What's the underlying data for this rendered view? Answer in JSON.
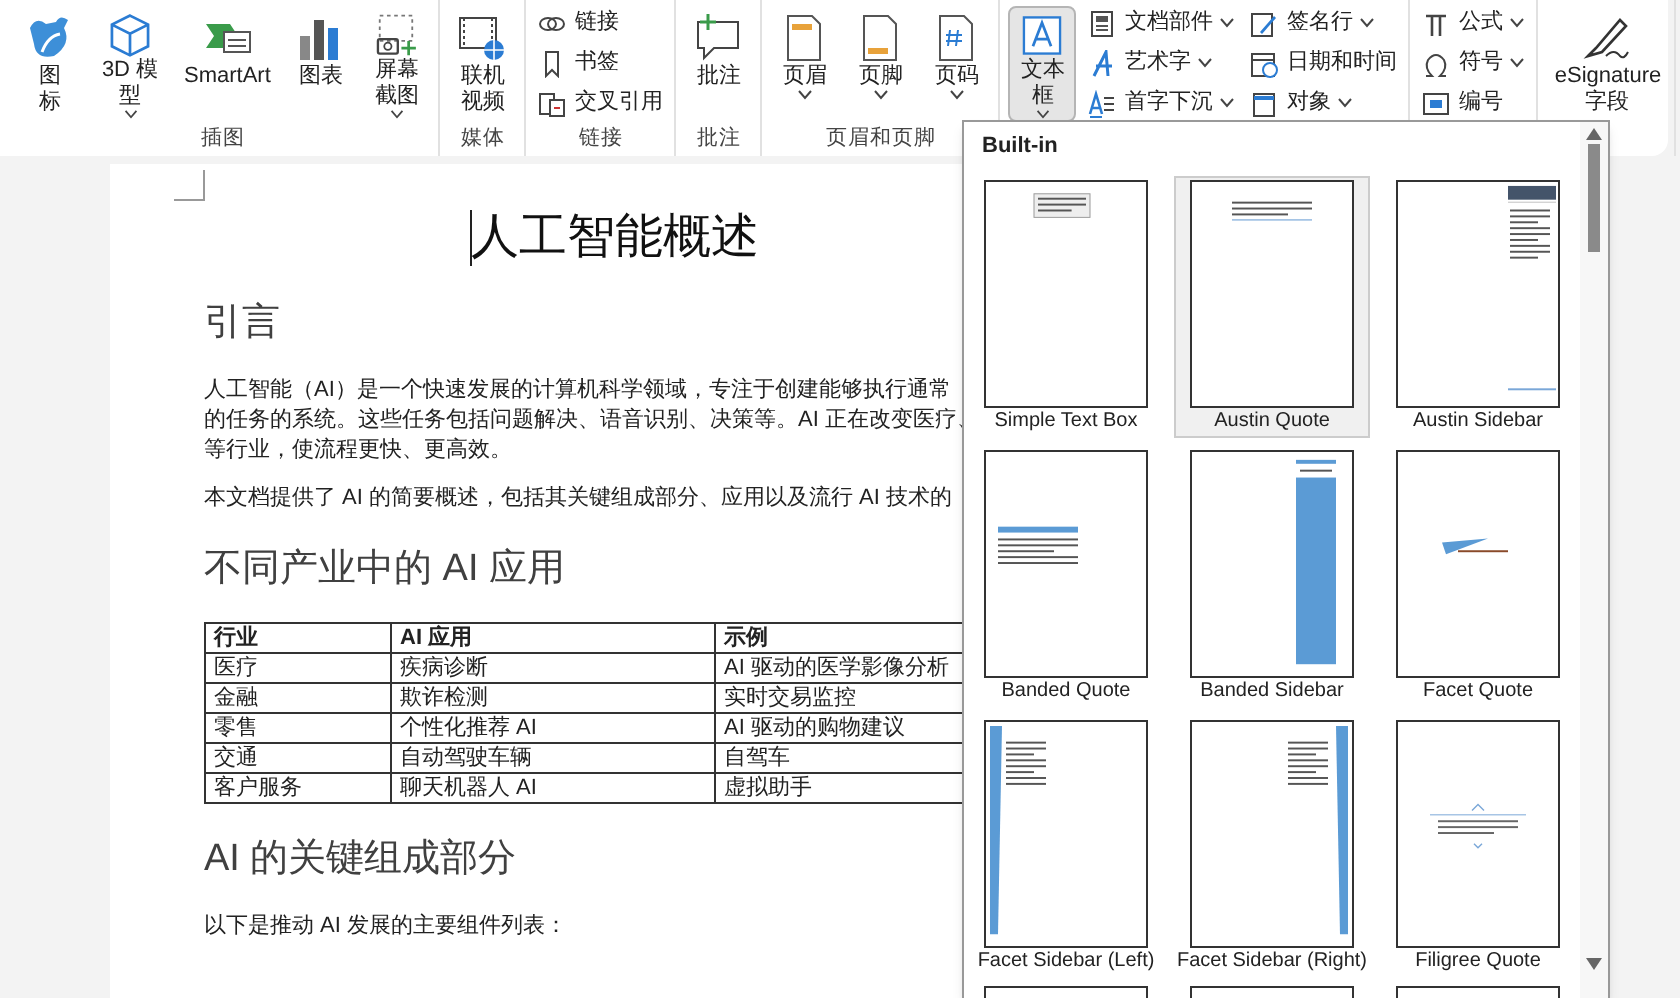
{
  "ribbon": {
    "groups": [
      {
        "label": "插图",
        "items": [
          {
            "kind": "large",
            "label": "图标",
            "has_menu": false,
            "selected": false
          },
          {
            "kind": "large",
            "label": "3D 模型",
            "has_menu": true,
            "selected": false
          },
          {
            "kind": "large",
            "label": "SmartArt",
            "has_menu": false,
            "selected": false
          },
          {
            "kind": "large",
            "label": "图表",
            "has_menu": false,
            "selected": false
          },
          {
            "kind": "large",
            "label": "屏幕截图",
            "has_menu": true,
            "selected": false
          }
        ]
      },
      {
        "label": "媒体",
        "items": [
          {
            "kind": "large",
            "label": "联机视频",
            "has_menu": false,
            "selected": false
          }
        ]
      },
      {
        "label": "链接",
        "items": [
          {
            "kind": "stack",
            "children": [
              {
                "label": "链接",
                "has_menu": false
              },
              {
                "label": "书签",
                "has_menu": false
              },
              {
                "label": "交叉引用",
                "has_menu": false
              }
            ]
          }
        ]
      },
      {
        "label": "批注",
        "items": [
          {
            "kind": "large",
            "label": "批注",
            "has_menu": false,
            "selected": false
          }
        ]
      },
      {
        "label": "页眉和页脚",
        "items": [
          {
            "kind": "large",
            "label": "页眉",
            "has_menu": true,
            "selected": false
          },
          {
            "kind": "large",
            "label": "页脚",
            "has_menu": true,
            "selected": false
          },
          {
            "kind": "large",
            "label": "页码",
            "has_menu": true,
            "selected": false
          }
        ]
      },
      {
        "items": [
          {
            "kind": "large",
            "label": "文本框",
            "has_menu": true,
            "selected": true
          },
          {
            "kind": "stack",
            "children": [
              {
                "label": "文档部件",
                "has_menu": true
              },
              {
                "label": "艺术字",
                "has_menu": true
              },
              {
                "label": "首字下沉",
                "has_menu": true
              }
            ]
          },
          {
            "kind": "stack",
            "children": [
              {
                "label": "签名行",
                "has_menu": true
              },
              {
                "label": "日期和时间",
                "has_menu": false
              },
              {
                "label": "对象",
                "has_menu": true
              }
            ]
          }
        ]
      },
      {
        "items": [
          {
            "kind": "stack",
            "children": [
              {
                "label": "公式",
                "has_menu": true
              },
              {
                "label": "符号",
                "has_menu": true
              },
              {
                "label": "编号",
                "has_menu": false
              }
            ]
          }
        ]
      },
      {
        "items": [
          {
            "kind": "large",
            "label": "eSignature 字段",
            "has_menu": false,
            "selected": false
          }
        ]
      }
    ]
  },
  "document": {
    "title": "人工智能概述",
    "blocks": [
      {
        "kind": "heading",
        "text": "引言"
      },
      {
        "kind": "paragraph",
        "lines": [
          "人工智能（AI）是一个快速发展的计算机科学领域，专注于创建能够执行通常",
          "的任务的系统。这些任务包括问题解决、语音识别、决策等。AI 正在改变医疗、",
          "等行业，使流程更快、更高效。"
        ]
      },
      {
        "kind": "paragraph",
        "lines": [
          "本文档提供了 AI 的简要概述，包括其关键组成部分、应用以及流行 AI 技术的"
        ]
      },
      {
        "kind": "heading",
        "text": "不同产业中的 AI 应用"
      },
      {
        "kind": "table",
        "columns": [
          "行业",
          "AI 应用",
          "示例"
        ],
        "rows": [
          [
            "医疗",
            "疾病诊断",
            "AI 驱动的医学影像分析"
          ],
          [
            "金融",
            "欺诈检测",
            "实时交易监控"
          ],
          [
            "零售",
            "个性化推荐 AI",
            "AI 驱动的购物建议"
          ],
          [
            "交通",
            "自动驾驶车辆",
            "自驾车"
          ],
          [
            "客户服务",
            "聊天机器人 AI",
            "虚拟助手"
          ]
        ]
      },
      {
        "kind": "heading",
        "text": "AI 的关键组成部分"
      },
      {
        "kind": "paragraph",
        "lines": [
          "以下是推动 AI 发展的主要组件列表："
        ]
      }
    ]
  },
  "gallery": {
    "title": "Built-in",
    "items": [
      {
        "label": "Simple Text Box",
        "kind": "simple",
        "selected": false
      },
      {
        "label": "Austin Quote",
        "kind": "austin-quote",
        "selected": true
      },
      {
        "label": "Austin Sidebar",
        "kind": "austin-sidebar",
        "selected": false
      },
      {
        "label": "Banded Quote",
        "kind": "banded-quote",
        "selected": false
      },
      {
        "label": "Banded Sidebar",
        "kind": "banded-sidebar",
        "selected": false
      },
      {
        "label": "Facet Quote",
        "kind": "facet-quote",
        "selected": false
      },
      {
        "label": "Facet Sidebar (Left)",
        "kind": "facet-left",
        "selected": false
      },
      {
        "label": "Facet Sidebar (Right)",
        "kind": "facet-right",
        "selected": false
      },
      {
        "label": "Filigree Quote",
        "kind": "filigree",
        "selected": false
      }
    ]
  }
}
